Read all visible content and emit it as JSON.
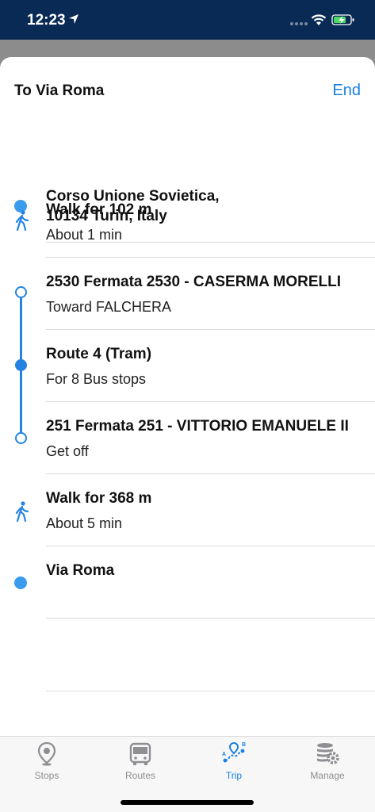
{
  "status_bar": {
    "time": "12:23"
  },
  "header": {
    "title": "To Via Roma",
    "end_label": "End"
  },
  "steps": [
    {
      "title": "Corso Unione Sovietica,\n10134 Turin, Italy",
      "subtitle": ""
    },
    {
      "title": "Walk for 102 m",
      "subtitle": "About 1 min"
    },
    {
      "title": "2530 Fermata 2530 - CASERMA MORELLI",
      "subtitle": "Toward FALCHERA"
    },
    {
      "title": "Route 4 (Tram)",
      "subtitle": "For 8 Bus stops"
    },
    {
      "title": "251 Fermata 251 - VITTORIO EMANUELE II",
      "subtitle": "Get off"
    },
    {
      "title": "Walk for 368 m",
      "subtitle": "About 5 min"
    },
    {
      "title": "Via Roma",
      "subtitle": ""
    }
  ],
  "tabs": [
    {
      "label": "Stops",
      "icon": "map-pin-icon",
      "active": false
    },
    {
      "label": "Routes",
      "icon": "bus-icon",
      "active": false
    },
    {
      "label": "Trip",
      "icon": "trip-route-icon",
      "active": true
    },
    {
      "label": "Manage",
      "icon": "database-gear-icon",
      "active": false
    }
  ],
  "colors": {
    "accent": "#1a80e0",
    "route": "#2483e2",
    "status_bar": "#082a55"
  }
}
